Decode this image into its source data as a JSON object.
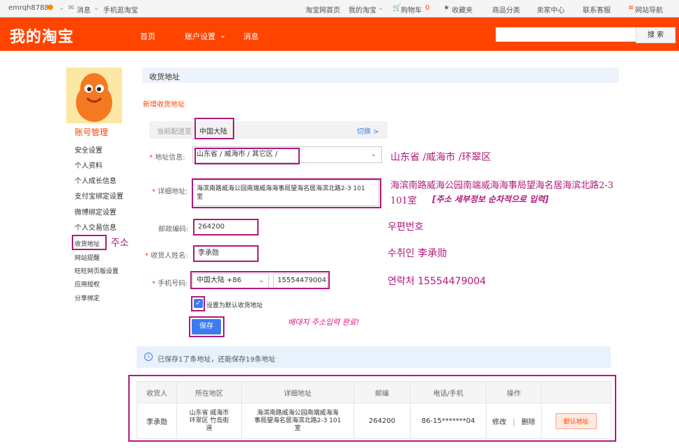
{
  "topbar": {
    "username": "emrqh8788",
    "messages": "消息",
    "mobile": "手机逛淘宝",
    "home": "淘宝网首页",
    "my_taobao": "我的淘宝",
    "cart": "购物车",
    "cart_count": "0",
    "favorites": "收藏夹",
    "categories": "商品分类",
    "seller_center": "卖家中心",
    "customer_service": "联系客服",
    "site_nav": "网站导航"
  },
  "header": {
    "logo": "我的淘宝",
    "nav": [
      "首页",
      "账户设置",
      "消息"
    ],
    "search_button": "搜 索",
    "accent": "#ff4400"
  },
  "sidebar": {
    "title": "账号管理",
    "items": [
      "安全设置",
      "个人资料",
      "个人成长信息",
      "支付宝绑定设置",
      "微博绑定设置",
      "个人交易信息",
      "收货地址",
      "网站提醒",
      "旺旺网页版设置",
      "应用授权",
      "分享绑定"
    ],
    "annotation": "주소"
  },
  "main": {
    "section_title": "收货地址",
    "new_address": "新增收货地址",
    "deliver_label": "当前配送至",
    "deliver_region": "中国大陆",
    "switch": "切换 >",
    "address_label": "地址信息:",
    "address_value": "山东省 / 威海市 / 其它区 /",
    "address_annotation": "山东省  /威海市  /环翠区",
    "detail_label": "详细地址:",
    "detail_value_1": "海滨南路威海公园南端威海海事局望海名居海滨北路2-3 101",
    "detail_value_2": "室",
    "detail_annotation_1": "海滨南路威海公园南端威海海事局望海名居海滨北路2-3",
    "detail_annotation_2": "101室",
    "detail_annotation_3": "[주소 세부정보 순차적으로 입력]",
    "zip_label": "邮政编码:",
    "zip_value": "264200",
    "zip_annotation": "우편번호",
    "name_label": "收货人姓名:",
    "name_value": "李承勋",
    "name_annotation": "수취인 李承勋",
    "phone_label": "手机号码:",
    "phone_region": "中国大陆 +86",
    "phone_value": "15554479004",
    "phone_annotation": "연락처 15554479004",
    "default_checkbox": "设置为默认收货地址",
    "save_button": "保存",
    "done_annotation": "배대지 주소입력 완료!",
    "info_text": "已保存1了条地址，还能保存19条地址"
  },
  "table": {
    "headers": [
      "收货人",
      "所在地区",
      "详细地址",
      "邮编",
      "电话/手机",
      "操作",
      ""
    ],
    "row": {
      "name": "李承勋",
      "region_1": "山东省 威海市",
      "region_2": "环翠区 竹岛街",
      "region_3": "道",
      "detail_1": "海滨南路威海公园南端威海海",
      "detail_2": "事局望海名居海滨北路2-3 101",
      "detail_3": "室",
      "zip": "264200",
      "phone": "86-15*******04",
      "edit": "修改",
      "sep": "|",
      "delete": "删除",
      "default_badge": "默认地址"
    }
  },
  "colors": {
    "annotation": "#b0187a",
    "accent": "#ff4400",
    "save": "#3d7bf2"
  }
}
